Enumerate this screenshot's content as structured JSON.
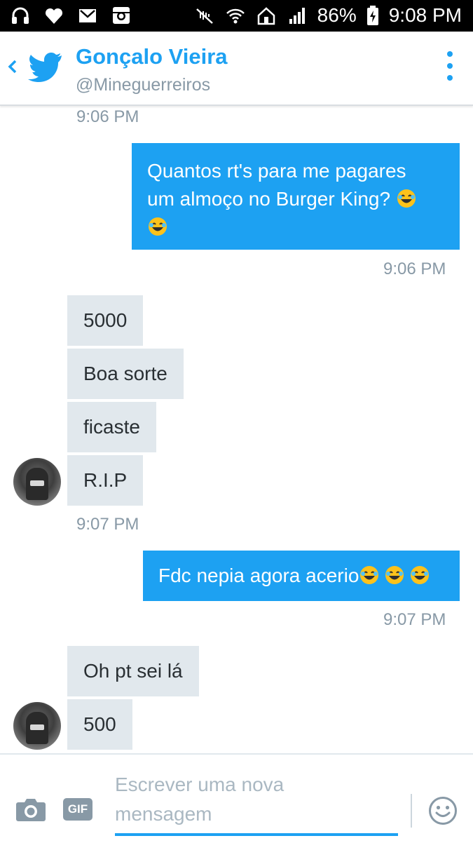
{
  "status_bar": {
    "battery": "86%",
    "time": "9:08 PM"
  },
  "header": {
    "name": "Gonçalo Vieira",
    "handle": "@Mineguerreiros"
  },
  "messages": {
    "ts1": "9:06 PM",
    "sent1_line1": "Quantos rt's para me pagares",
    "sent1_line2": "um almoço no Burger King?",
    "ts2": "9:06 PM",
    "recv1": "5000",
    "recv2": "Boa sorte",
    "recv3": "ficaste",
    "recv4": "R.I.P",
    "ts3": "9:07 PM",
    "sent2": "Fdc nepia agora acerio",
    "ts4": "9:07 PM",
    "recv5": "Oh pt sei lá",
    "recv6": "500"
  },
  "composer": {
    "gif_label": "GIF",
    "placeholder_line1": "Escrever uma nova",
    "placeholder_line2": "mensagem"
  },
  "colors": {
    "accent": "#1da1f2",
    "received_bubble": "#e1e8ed",
    "timestamp": "#8899a6"
  },
  "icons": [
    "headphones-icon",
    "heart-icon",
    "gmail-icon",
    "instagram-icon",
    "mute-icon",
    "wifi-icon",
    "home-icon",
    "signal-icon",
    "battery-icon",
    "back-icon",
    "twitter-bird-icon",
    "more-vertical-icon",
    "camera-icon",
    "gif-icon",
    "emoji-icon",
    "laughing-emoji-icon"
  ]
}
